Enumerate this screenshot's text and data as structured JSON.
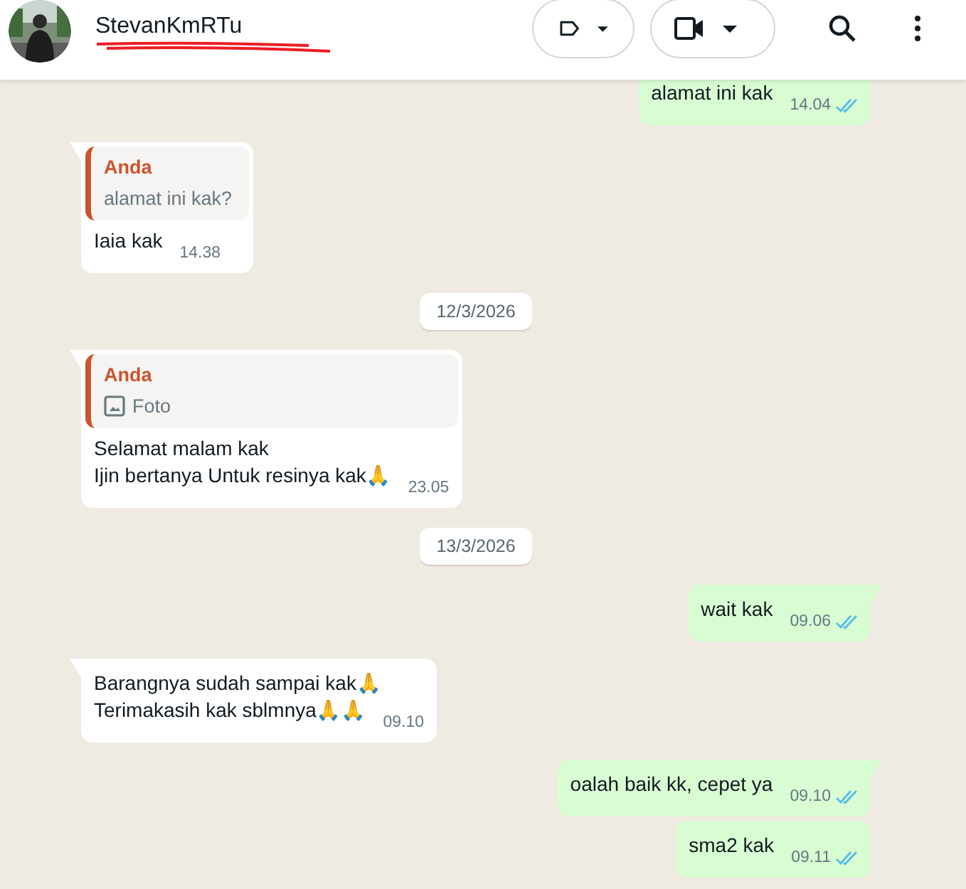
{
  "header": {
    "contact_name": "StevanKmRTu",
    "redacted": true
  },
  "messages": [
    {
      "kind": "message",
      "outgoing": true,
      "text": "alamat ini kak",
      "time": "14.04",
      "read": true,
      "tail": false
    },
    {
      "kind": "message",
      "outgoing": false,
      "quote": {
        "author": "Anda",
        "photo": false,
        "text": "alamat ini kak?"
      },
      "text": "Iaia kak",
      "time": "14.38",
      "tail": true
    },
    {
      "kind": "date",
      "text": "12/3/2026"
    },
    {
      "kind": "message",
      "outgoing": false,
      "quote": {
        "author": "Anda",
        "photo": true,
        "text": "Foto"
      },
      "text": "Selamat malam kak\nIjin bertanya Untuk resinya kak🙏",
      "time": "23.05",
      "tail": true
    },
    {
      "kind": "date",
      "text": "13/3/2026"
    },
    {
      "kind": "message",
      "outgoing": true,
      "text": "wait kak",
      "time": "09.06",
      "read": true,
      "tail": true
    },
    {
      "kind": "message",
      "outgoing": false,
      "text": "Barangnya sudah sampai kak🙏\nTerimakasih kak sblmnya🙏🙏",
      "time": "09.10",
      "tail": true
    },
    {
      "kind": "message",
      "outgoing": true,
      "text": "oalah baik kk, cepet ya",
      "time": "09.10",
      "read": true,
      "tail": true
    },
    {
      "kind": "message",
      "outgoing": true,
      "text": "sma2 kak",
      "time": "09.11",
      "read": true,
      "tail": false
    }
  ]
}
